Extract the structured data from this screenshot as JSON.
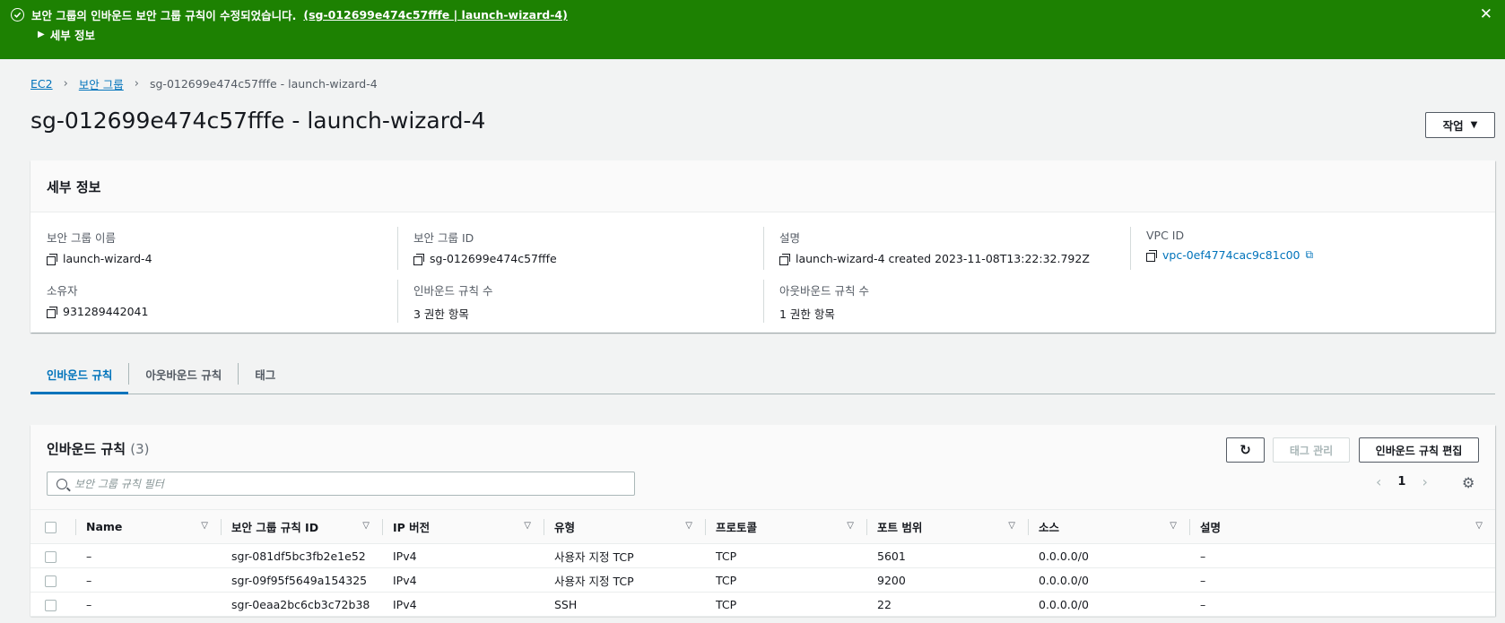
{
  "flash": {
    "message": "보안 그룹의 인바운드 보안 그룹 규칙이 수정되었습니다.",
    "link_text": "(sg-012699e474c57fffe | launch-wizard-4)",
    "details_toggle": "세부 정보",
    "close_symbol": "✕"
  },
  "breadcrumb": {
    "items": [
      "EC2",
      "보안 그룹"
    ],
    "current": "sg-012699e474c57fffe - launch-wizard-4"
  },
  "page": {
    "title": "sg-012699e474c57fffe - launch-wizard-4",
    "action_button": "작업"
  },
  "details": {
    "heading": "세부 정보",
    "fields": {
      "group_name_label": "보안 그룹 이름",
      "group_name": "launch-wizard-4",
      "group_id_label": "보안 그룹 ID",
      "group_id": "sg-012699e474c57fffe",
      "description_label": "설명",
      "description": "launch-wizard-4 created 2023-11-08T13:22:32.792Z",
      "vpc_id_label": "VPC ID",
      "vpc_id": "vpc-0ef4774cac9c81c00",
      "owner_label": "소유자",
      "owner": "931289442041",
      "inbound_count_label": "인바운드 규칙 수",
      "inbound_count": "3 권한 항목",
      "outbound_count_label": "아웃바운드 규칙 수",
      "outbound_count": "1 권한 항목"
    }
  },
  "tabs": [
    "인바운드 규칙",
    "아웃바운드 규칙",
    "태그"
  ],
  "rules": {
    "title": "인바운드 규칙",
    "count": "(3)",
    "manage_tags_button": "태그 관리",
    "edit_button": "인바운드 규칙 편집",
    "filter_placeholder": "보안 그룹 규칙 필터",
    "page_number": "1",
    "columns": [
      "Name",
      "보안 그룹 규칙 ID",
      "IP 버전",
      "유형",
      "프로토콜",
      "포트 범위",
      "소스",
      "설명"
    ],
    "rows": [
      [
        "–",
        "sgr-081df5bc3fb2e1e52",
        "IPv4",
        "사용자 지정 TCP",
        "TCP",
        "5601",
        "0.0.0.0/0",
        "–"
      ],
      [
        "–",
        "sgr-09f95f5649a154325",
        "IPv4",
        "사용자 지정 TCP",
        "TCP",
        "9200",
        "0.0.0.0/0",
        "–"
      ],
      [
        "–",
        "sgr-0eaa2bc6cb3c72b38",
        "IPv4",
        "SSH",
        "TCP",
        "22",
        "0.0.0.0/0",
        "–"
      ]
    ]
  },
  "colors": {
    "success": "#1d8102",
    "link": "#0073bb",
    "text": "#16191f"
  }
}
